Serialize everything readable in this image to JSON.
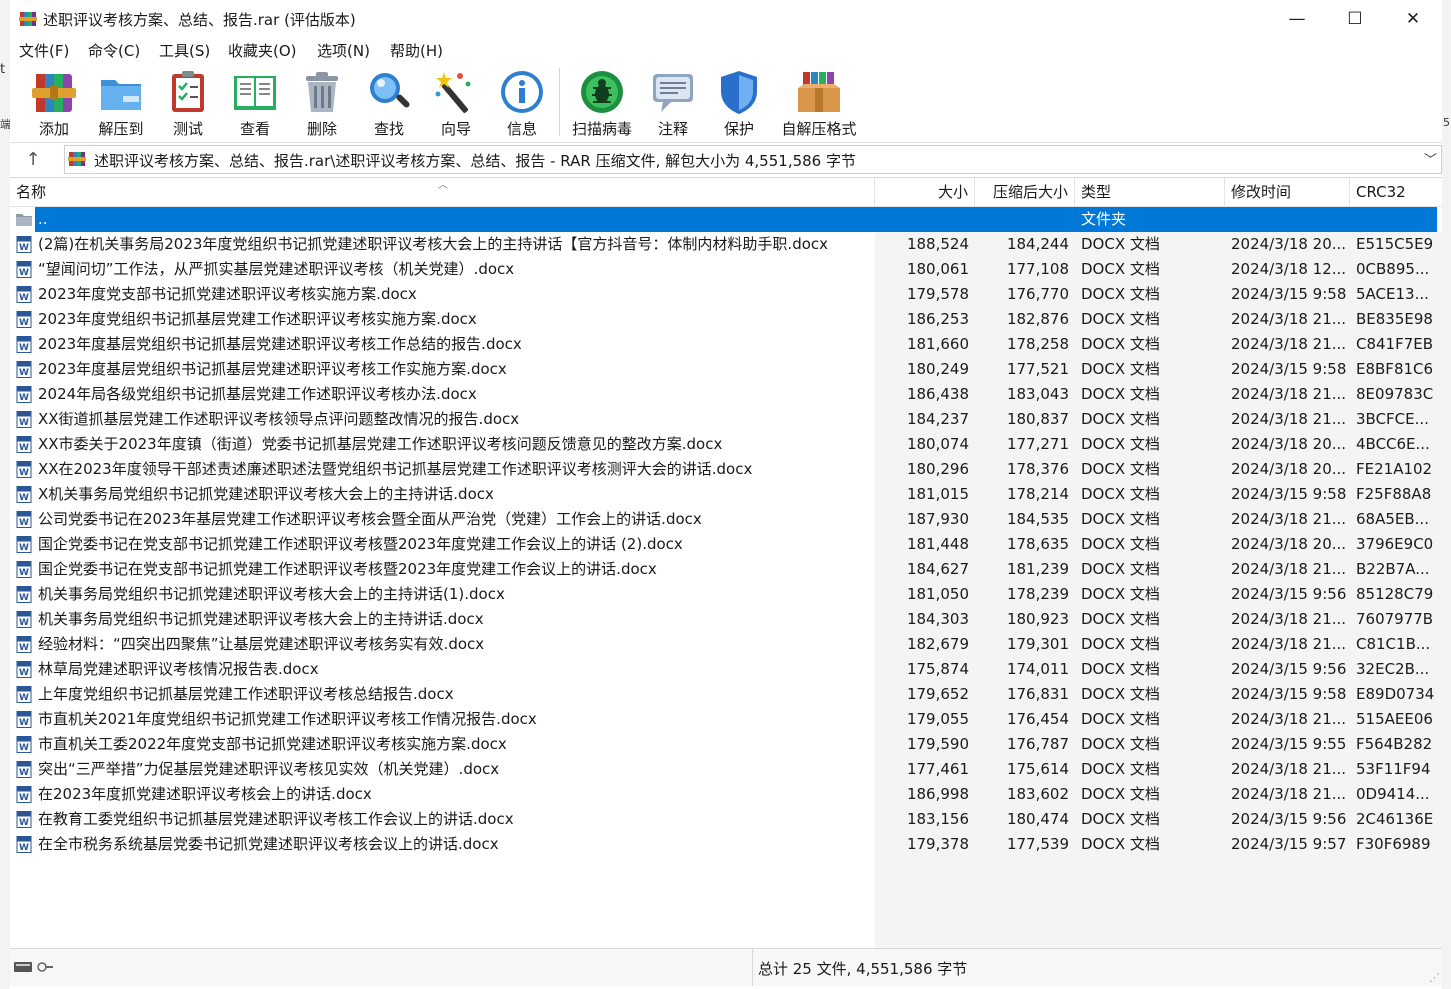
{
  "window": {
    "title": "述职评议考核方案、总结、报告.rar (评估版本)",
    "minimize": "—",
    "maximize": "☐",
    "close": "✕"
  },
  "menu": [
    {
      "label": "文件(F)"
    },
    {
      "label": "命令(C)"
    },
    {
      "label": "工具(S)"
    },
    {
      "label": "收藏夹(O)"
    },
    {
      "label": "选项(N)"
    },
    {
      "label": "帮助(H)"
    }
  ],
  "toolbar": [
    {
      "label": "添加",
      "icon": "add-icon"
    },
    {
      "label": "解压到",
      "icon": "extract-folder-icon"
    },
    {
      "label": "测试",
      "icon": "test-clipboard-icon"
    },
    {
      "label": "查看",
      "icon": "view-book-icon"
    },
    {
      "label": "删除",
      "icon": "trash-icon"
    },
    {
      "label": "查找",
      "icon": "magnifier-icon"
    },
    {
      "label": "向导",
      "icon": "wizard-wand-icon"
    },
    {
      "label": "信息",
      "icon": "info-icon"
    },
    {
      "label": "扫描病毒",
      "icon": "virus-scan-icon"
    },
    {
      "label": "注释",
      "icon": "comment-icon"
    },
    {
      "label": "保护",
      "icon": "shield-icon"
    },
    {
      "label": "自解压格式",
      "icon": "sfx-box-icon"
    }
  ],
  "address": {
    "path": "述职评议考核方案、总结、报告.rar\\述职评议考核方案、总结、报告 - RAR 压缩文件, 解包大小为 4,551,586 字节"
  },
  "columns": {
    "name": "名称",
    "size": "大小",
    "packed": "压缩后大小",
    "type": "类型",
    "modified": "修改时间",
    "crc": "CRC32"
  },
  "parent_row": {
    "name": "..",
    "type": "文件夹"
  },
  "files": [
    {
      "name": "(2篇)在机关事务局2023年度党组织书记抓党建述职评议考核大会上的主持讲话【官方抖音号：体制内材料助手职.docx",
      "size": "188,524",
      "packed": "184,244",
      "type": "DOCX 文档",
      "modified": "2024/3/18 20...",
      "crc": "E515C5E9"
    },
    {
      "name": "“望闻问切”工作法，从严抓实基层党建述职评议考核（机关党建）.docx",
      "size": "180,061",
      "packed": "177,108",
      "type": "DOCX 文档",
      "modified": "2024/3/18 12...",
      "crc": "0CB895..."
    },
    {
      "name": "2023年度党支部书记抓党建述职评议考核实施方案.docx",
      "size": "179,578",
      "packed": "176,770",
      "type": "DOCX 文档",
      "modified": "2024/3/15 9:58",
      "crc": "5ACE13..."
    },
    {
      "name": "2023年度党组织书记抓基层党建工作述职评议考核实施方案.docx",
      "size": "186,253",
      "packed": "182,876",
      "type": "DOCX 文档",
      "modified": "2024/3/18 21...",
      "crc": "BE835E98"
    },
    {
      "name": "2023年度基层党组织书记抓基层党建述职评议考核工作总结的报告.docx",
      "size": "181,660",
      "packed": "178,258",
      "type": "DOCX 文档",
      "modified": "2024/3/18 21...",
      "crc": "C841F7EB"
    },
    {
      "name": "2023年度基层党组织书记抓基层党建述职评议考核工作实施方案.docx",
      "size": "180,249",
      "packed": "177,521",
      "type": "DOCX 文档",
      "modified": "2024/3/15 9:58",
      "crc": "E8BF81C6"
    },
    {
      "name": "2024年局各级党组织书记抓基层党建工作述职评议考核办法.docx",
      "size": "186,438",
      "packed": "183,043",
      "type": "DOCX 文档",
      "modified": "2024/3/18 21...",
      "crc": "8E09783C"
    },
    {
      "name": "XX街道抓基层党建工作述职评议考核领导点评问题整改情况的报告.docx",
      "size": "184,237",
      "packed": "180,837",
      "type": "DOCX 文档",
      "modified": "2024/3/18 21...",
      "crc": "3BCFCE..."
    },
    {
      "name": "XX市委关于2023年度镇（街道）党委书记抓基层党建工作述职评议考核问题反馈意见的整改方案.docx",
      "size": "180,074",
      "packed": "177,271",
      "type": "DOCX 文档",
      "modified": "2024/3/18 20...",
      "crc": "4BCC6E..."
    },
    {
      "name": "XX在2023年度领导干部述责述廉述职述法暨党组织书记抓基层党建工作述职评议考核测评大会的讲话.docx",
      "size": "180,296",
      "packed": "178,376",
      "type": "DOCX 文档",
      "modified": "2024/3/18 20...",
      "crc": "FE21A102"
    },
    {
      "name": "X机关事务局党组织书记抓党建述职评议考核大会上的主持讲话.docx",
      "size": "181,015",
      "packed": "178,214",
      "type": "DOCX 文档",
      "modified": "2024/3/15 9:58",
      "crc": "F25F88A8"
    },
    {
      "name": "公司党委书记在2023年基层党建工作述职评议考核会暨全面从严治党（党建）工作会上的讲话.docx",
      "size": "187,930",
      "packed": "184,535",
      "type": "DOCX 文档",
      "modified": "2024/3/18 21...",
      "crc": "68A5EB..."
    },
    {
      "name": "国企党委书记在党支部书记抓党建工作述职评议考核暨2023年度党建工作会议上的讲话 (2).docx",
      "size": "181,448",
      "packed": "178,635",
      "type": "DOCX 文档",
      "modified": "2024/3/18 20...",
      "crc": "3796E9C0"
    },
    {
      "name": "国企党委书记在党支部书记抓党建工作述职评议考核暨2023年度党建工作会议上的讲话.docx",
      "size": "184,627",
      "packed": "181,239",
      "type": "DOCX 文档",
      "modified": "2024/3/18 21...",
      "crc": "B22B7A..."
    },
    {
      "name": "机关事务局党组织书记抓党建述职评议考核大会上的主持讲话(1).docx",
      "size": "181,050",
      "packed": "178,239",
      "type": "DOCX 文档",
      "modified": "2024/3/15 9:56",
      "crc": "85128C79"
    },
    {
      "name": "机关事务局党组织书记抓党建述职评议考核大会上的主持讲话.docx",
      "size": "184,303",
      "packed": "180,923",
      "type": "DOCX 文档",
      "modified": "2024/3/18 21...",
      "crc": "7607977B"
    },
    {
      "name": "经验材料：“四突出四聚焦”让基层党建述职评议考核务实有效.docx",
      "size": "182,679",
      "packed": "179,301",
      "type": "DOCX 文档",
      "modified": "2024/3/18 21...",
      "crc": "C81C1B..."
    },
    {
      "name": "林草局党建述职评议考核情况报告表.docx",
      "size": "175,874",
      "packed": "174,011",
      "type": "DOCX 文档",
      "modified": "2024/3/15 9:56",
      "crc": "32EC2B..."
    },
    {
      "name": "上年度党组织书记抓基层党建工作述职评议考核总结报告.docx",
      "size": "179,652",
      "packed": "176,831",
      "type": "DOCX 文档",
      "modified": "2024/3/15 9:58",
      "crc": "E89D0734"
    },
    {
      "name": "市直机关2021年度党组织书记抓党建工作述职评议考核工作情况报告.docx",
      "size": "179,055",
      "packed": "176,454",
      "type": "DOCX 文档",
      "modified": "2024/3/18 21...",
      "crc": "515AEE06"
    },
    {
      "name": "市直机关工委2022年度党支部书记抓党建述职评议考核实施方案.docx",
      "size": "179,590",
      "packed": "176,787",
      "type": "DOCX 文档",
      "modified": "2024/3/15 9:55",
      "crc": "F564B282"
    },
    {
      "name": "突出“三严举措”力促基层党建述职评议考核见实效（机关党建）.docx",
      "size": "177,461",
      "packed": "175,614",
      "type": "DOCX 文档",
      "modified": "2024/3/18 21...",
      "crc": "53F11F94"
    },
    {
      "name": "在2023年度抓党建述职评议考核会上的讲话.docx",
      "size": "186,998",
      "packed": "183,602",
      "type": "DOCX 文档",
      "modified": "2024/3/18 21...",
      "crc": "0D9414..."
    },
    {
      "name": "在教育工委党组织书记抓基层党建述职评议考核工作会议上的讲话.docx",
      "size": "183,156",
      "packed": "180,474",
      "type": "DOCX 文档",
      "modified": "2024/3/15 9:56",
      "crc": "2C46136E"
    },
    {
      "name": "在全市税务系统基层党委书记抓党建述职评议考核会议上的讲话.docx",
      "size": "179,378",
      "packed": "177,539",
      "type": "DOCX 文档",
      "modified": "2024/3/15 9:57",
      "crc": "F30F6989"
    }
  ],
  "status": {
    "summary": "总计 25 文件, 4,551,586 字节"
  },
  "colors": {
    "selection": "#0078d7",
    "word_icon": "#2b5797",
    "folder_icon": "#8a9aa8"
  }
}
